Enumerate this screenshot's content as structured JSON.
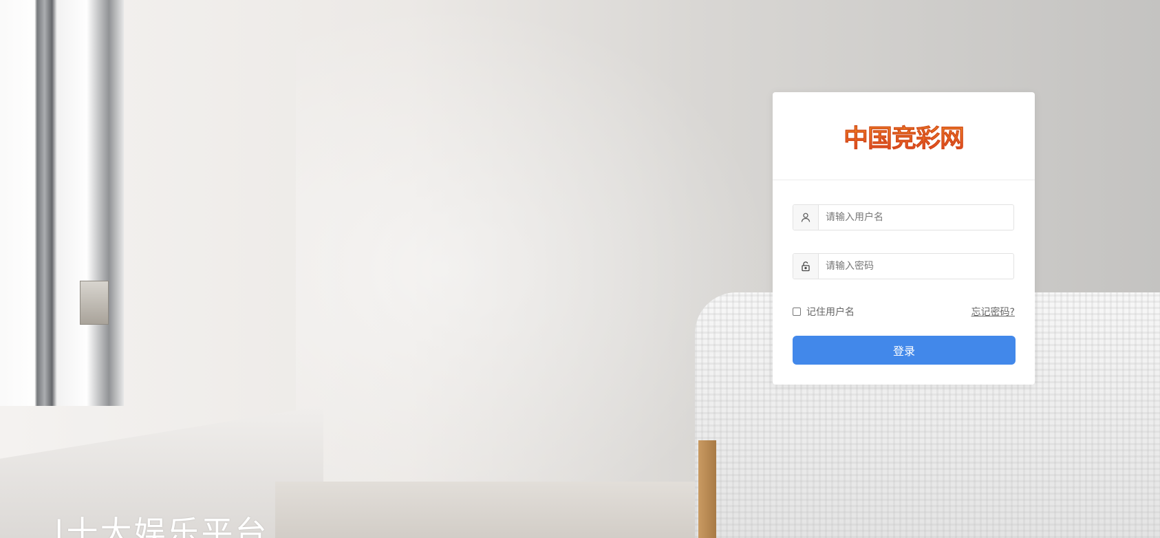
{
  "background": {
    "slogan": "|十大娱乐平台"
  },
  "login": {
    "logo_text": "中国竞彩网",
    "username_placeholder": "请输入用户名",
    "password_placeholder": "请输入密码",
    "remember_label": "记住用户名",
    "forgot_label": "忘记密码?",
    "submit_label": "登录",
    "icons": {
      "username": "user-icon",
      "password": "unlock-icon"
    },
    "colors": {
      "button": "#4288ea",
      "logo_top": "#f6a623",
      "logo_bottom": "#e0321f"
    }
  }
}
